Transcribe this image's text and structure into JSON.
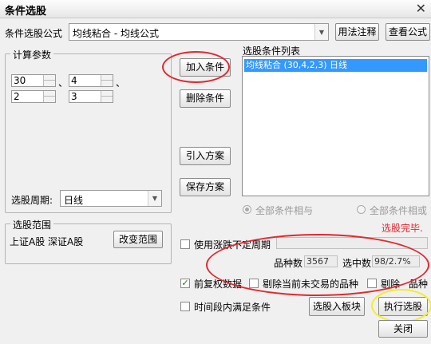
{
  "window": {
    "title": "条件选股",
    "close_glyph": "✕"
  },
  "formula": {
    "label": "条件选股公式",
    "value": "均线粘合        - 均线公式",
    "usage_button": "用法注释",
    "view_button": "查看公式"
  },
  "params": {
    "group_title": "计算参数",
    "values": [
      "30",
      "4",
      "2",
      "3"
    ],
    "sep1": "、",
    "sep2": "、",
    "period_label": "选股周期:",
    "period_value": "日线"
  },
  "actions": {
    "add": "加入条件",
    "delete": "删除条件",
    "import": "引入方案",
    "save": "保存方案"
  },
  "conditions": {
    "list_title": "选股条件列表",
    "items": [
      "均线粘合 (30,4,2,3) 日线"
    ]
  },
  "logic": {
    "and_label": "全部条件相与",
    "or_label": "全部条件相或"
  },
  "status": {
    "done": "选股完毕."
  },
  "range": {
    "group_title": "选股范围",
    "value": "上证A股 深证A股",
    "change_button": "改变范围"
  },
  "options": {
    "undetermined_period": "使用涨跌不定周期",
    "count_label": "品种数",
    "count_value": "3567",
    "selected_label": "选中数",
    "selected_value": "98/2.7%",
    "forward_adjust": "前复权数据",
    "exclude_untraded": "剔除当前未交易的品种",
    "exclude_partial": "剔除",
    "exclude_tail": "品种",
    "time_segment": "时间段内满足条件"
  },
  "bottom": {
    "to_block": "选股入板块",
    "execute": "执行选股",
    "close": "关闭"
  },
  "colors": {
    "highlight_ring": "#e2272f",
    "execute_ring": "#f2ee2a",
    "selection": "#3399ff",
    "status_red": "#e2272f"
  }
}
